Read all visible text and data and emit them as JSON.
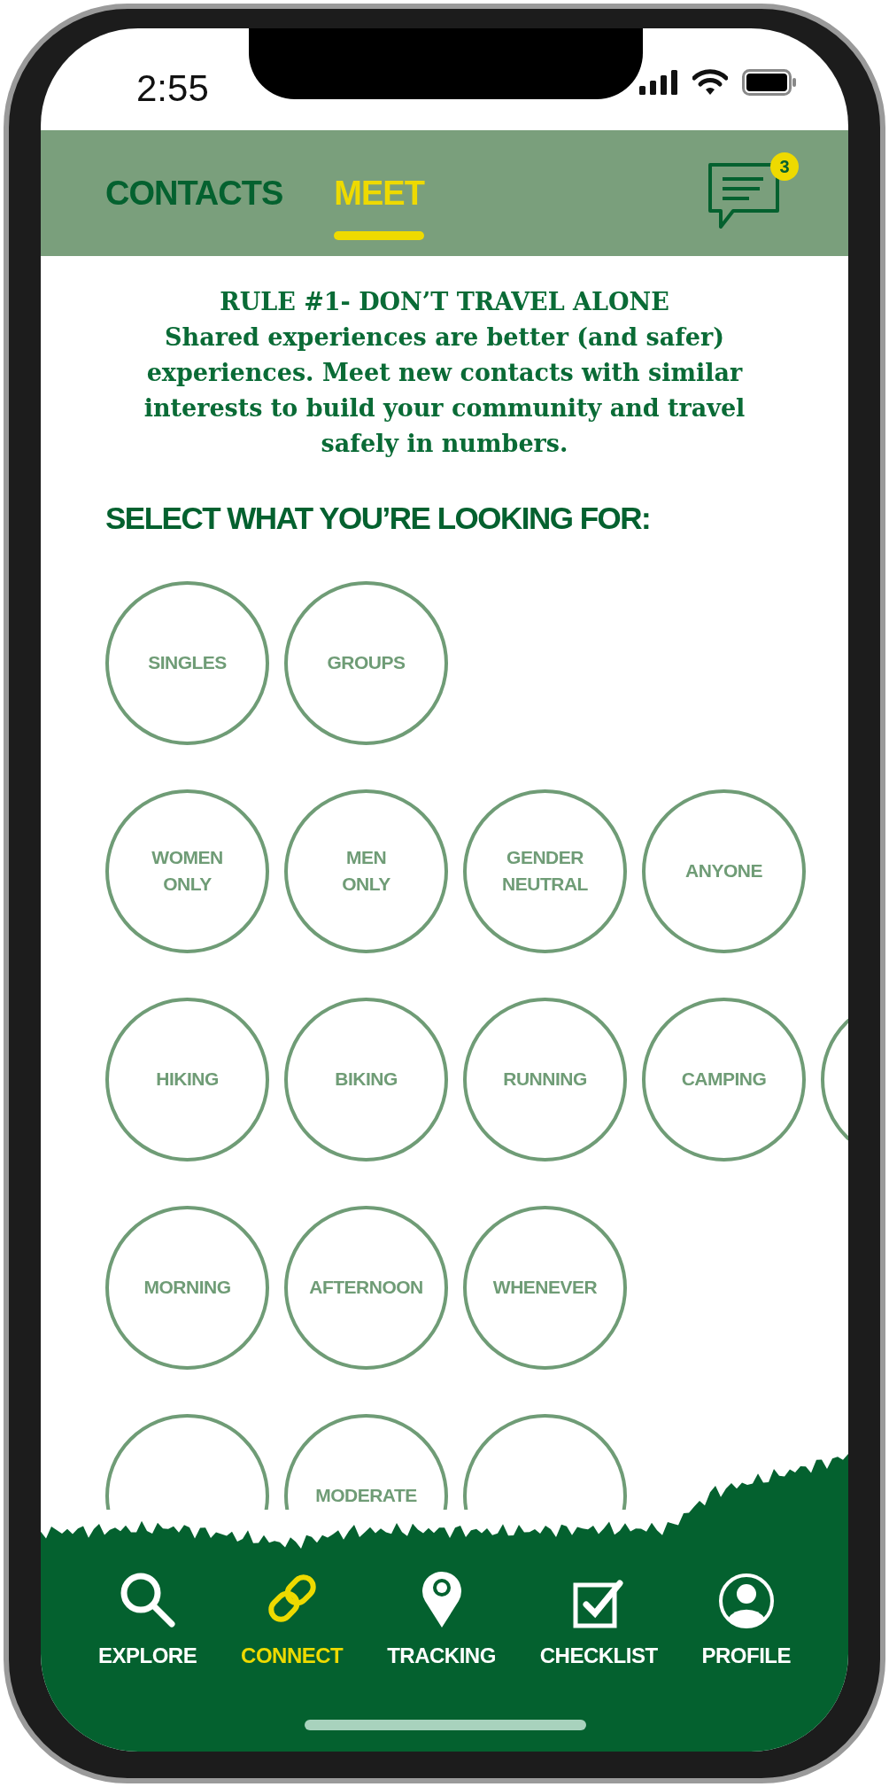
{
  "status_bar": {
    "time": "2:55"
  },
  "tabs": [
    {
      "label": "CONTACTS",
      "selected": false
    },
    {
      "label": "MEET",
      "selected": true
    }
  ],
  "messages": {
    "badge": "3"
  },
  "intro": {
    "title": "RULE #1- DON’T TRAVEL ALONE",
    "body": "Shared experiences are better (and safer) experiences. Meet new contacts with similar interests to build your community and travel safely in numbers."
  },
  "prompt": "SELECT WHAT YOU’RE LOOKING FOR:",
  "option_groups": [
    {
      "options": [
        {
          "label": "SINGLES",
          "selected": false
        },
        {
          "label": "GROUPS",
          "selected": false
        }
      ]
    },
    {
      "options": [
        {
          "label": "WOMEN ONLY",
          "selected": false
        },
        {
          "label": "MEN ONLY",
          "selected": false
        },
        {
          "label": "GENDER NEUTRAL",
          "selected": false
        },
        {
          "label": "ANYONE",
          "selected": false
        }
      ]
    },
    {
      "options": [
        {
          "label": "HIKING",
          "selected": false
        },
        {
          "label": "BIKING",
          "selected": false
        },
        {
          "label": "RUNNING",
          "selected": false
        },
        {
          "label": "CAMPING",
          "selected": false
        },
        {
          "selected": false
        }
      ]
    },
    {
      "options": [
        {
          "label": "MORNING",
          "selected": false
        },
        {
          "label": "AFTERNOON",
          "selected": false
        },
        {
          "label": "WHENEVER",
          "selected": false
        }
      ]
    },
    {
      "options": [
        {
          "selected": false
        },
        {
          "label": "MODERATE",
          "selected": false
        },
        {
          "selected": false
        }
      ]
    }
  ],
  "nav": [
    {
      "label": "EXPLORE",
      "kind": "search",
      "selected": false
    },
    {
      "label": "CONNECT",
      "kind": "link",
      "selected": true
    },
    {
      "label": "TRACKING",
      "kind": "pin",
      "selected": false
    },
    {
      "label": "CHECKLIST",
      "kind": "checklist",
      "selected": false
    },
    {
      "label": "PROFILE",
      "kind": "profile",
      "selected": false
    }
  ]
}
